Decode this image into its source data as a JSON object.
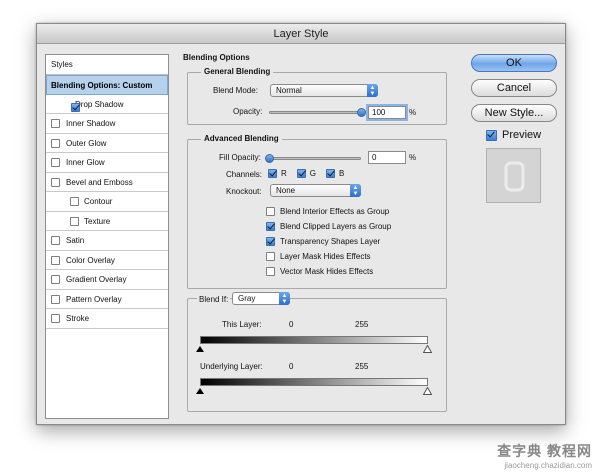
{
  "window": {
    "title": "Layer Style"
  },
  "styles": {
    "header": "Styles",
    "items": [
      {
        "label": "Blending Options: Custom",
        "selected": true,
        "checkbox": false,
        "checked": false,
        "indent": false
      },
      {
        "label": "Drop Shadow",
        "selected": false,
        "checkbox": true,
        "checked": true,
        "indent": false
      },
      {
        "label": "Inner Shadow",
        "selected": false,
        "checkbox": true,
        "checked": false,
        "indent": false
      },
      {
        "label": "Outer Glow",
        "selected": false,
        "checkbox": true,
        "checked": false,
        "indent": false
      },
      {
        "label": "Inner Glow",
        "selected": false,
        "checkbox": true,
        "checked": false,
        "indent": false
      },
      {
        "label": "Bevel and Emboss",
        "selected": false,
        "checkbox": true,
        "checked": false,
        "indent": false
      },
      {
        "label": "Contour",
        "selected": false,
        "checkbox": true,
        "checked": false,
        "indent": true
      },
      {
        "label": "Texture",
        "selected": false,
        "checkbox": true,
        "checked": false,
        "indent": true
      },
      {
        "label": "Satin",
        "selected": false,
        "checkbox": true,
        "checked": false,
        "indent": false
      },
      {
        "label": "Color Overlay",
        "selected": false,
        "checkbox": true,
        "checked": false,
        "indent": false
      },
      {
        "label": "Gradient Overlay",
        "selected": false,
        "checkbox": true,
        "checked": false,
        "indent": false
      },
      {
        "label": "Pattern Overlay",
        "selected": false,
        "checkbox": true,
        "checked": false,
        "indent": false
      },
      {
        "label": "Stroke",
        "selected": false,
        "checkbox": true,
        "checked": false,
        "indent": false
      }
    ]
  },
  "blending_options": {
    "title": "Blending Options",
    "general": {
      "title": "General Blending",
      "blend_mode_label": "Blend Mode:",
      "blend_mode_value": "Normal",
      "opacity_label": "Opacity:",
      "opacity_value": "100",
      "opacity_unit": "%",
      "opacity_fraction": 1.0
    },
    "advanced": {
      "title": "Advanced Blending",
      "fill_opacity_label": "Fill Opacity:",
      "fill_opacity_value": "0",
      "fill_opacity_unit": "%",
      "fill_opacity_fraction": 0.0,
      "channels_label": "Channels:",
      "channels": [
        {
          "label": "R",
          "checked": true
        },
        {
          "label": "G",
          "checked": true
        },
        {
          "label": "B",
          "checked": true
        }
      ],
      "knockout_label": "Knockout:",
      "knockout_value": "None",
      "options": [
        {
          "label": "Blend Interior Effects as Group",
          "checked": false
        },
        {
          "label": "Blend Clipped Layers as Group",
          "checked": true
        },
        {
          "label": "Transparency Shapes Layer",
          "checked": true
        },
        {
          "label": "Layer Mask Hides Effects",
          "checked": false
        },
        {
          "label": "Vector Mask Hides Effects",
          "checked": false
        }
      ]
    },
    "blend_if": {
      "label": "Blend If:",
      "value": "Gray",
      "this_layer_label": "This Layer:",
      "this_layer_low": "0",
      "this_layer_high": "255",
      "underlying_label": "Underlying Layer:",
      "underlying_low": "0",
      "underlying_high": "255"
    }
  },
  "buttons": {
    "ok": "OK",
    "cancel": "Cancel",
    "new_style": "New Style...",
    "preview_label": "Preview",
    "preview_checked": true
  },
  "watermark": {
    "main": "查字典 教程网",
    "url": "jiaocheng.chazidian.com"
  }
}
